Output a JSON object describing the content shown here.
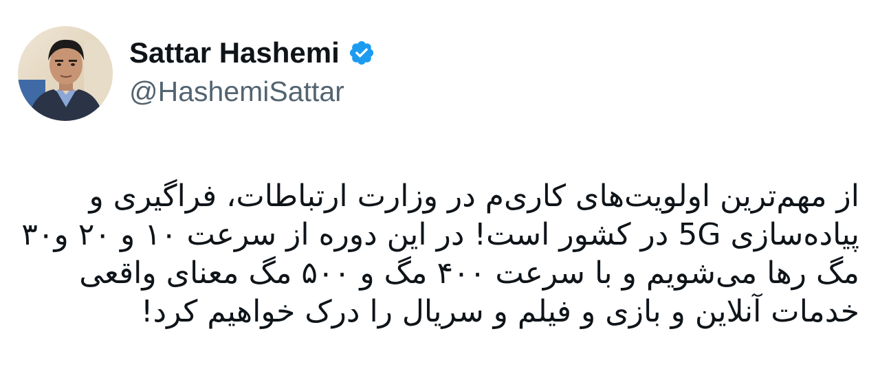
{
  "author": {
    "display_name": "Sattar Hashemi",
    "handle": "@HashemiSattar",
    "verified": true,
    "verified_icon": "verified-badge-icon",
    "avatar_icon": "profile-photo"
  },
  "tweet": {
    "lines": [
      "از مهم‌ترین اولویت‌های کاری‌م در وزارت ارتباطات، فراگیری و",
      "پیاده‌سازی 5G در کشور است! در این دوره از سرعت ۱۰ و ۲۰ و۳۰",
      "مگ رها می‌شویم و با سرعت ۴۰۰ مگ و ۵۰۰ مگ معنای واقعی",
      "خدمات آنلاین و بازی و فیلم و سریال را درک خواهیم کرد!"
    ]
  },
  "colors": {
    "name": "#0f1419",
    "handle": "#536471",
    "verified": "#1d9bf0",
    "background": "#ffffff"
  }
}
